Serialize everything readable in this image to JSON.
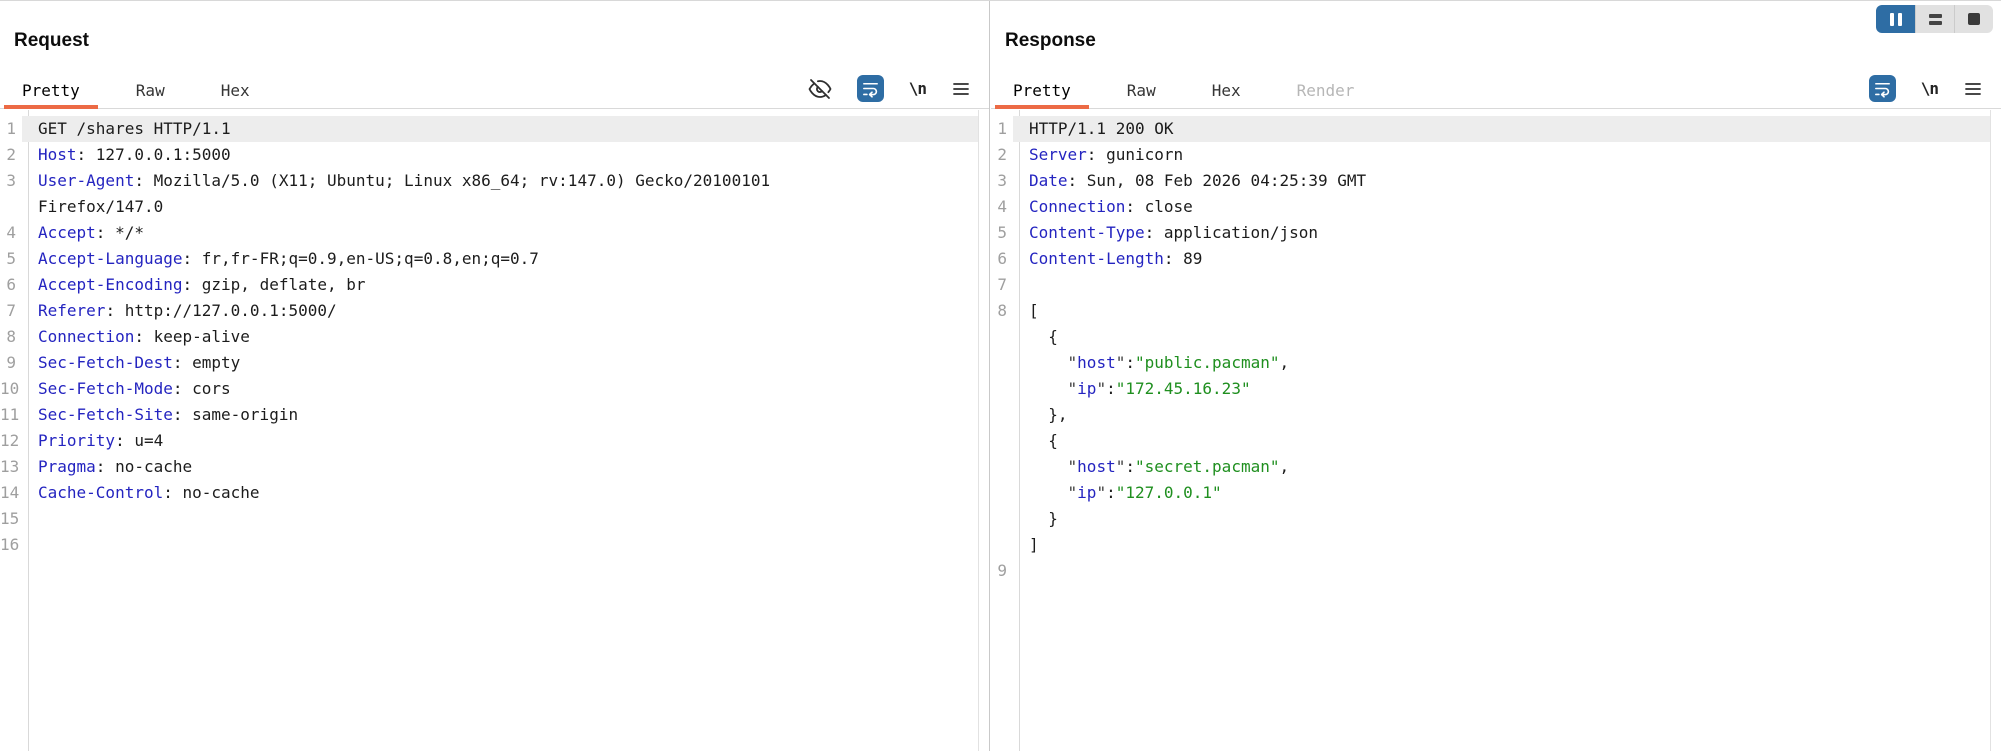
{
  "colors": {
    "tab_underline_orange": "#ec6a45",
    "accent_blue": "#2e6da4",
    "header_name_blue": "#2424c0",
    "string_green": "#1f8f1f",
    "selected_line_bg": "#ededed"
  },
  "request_panel": {
    "title": "Request",
    "tabs": [
      {
        "label": "Pretty",
        "state": "selected"
      },
      {
        "label": "Raw",
        "state": "normal"
      },
      {
        "label": "Hex",
        "state": "normal"
      }
    ],
    "toolbar": {
      "icons": [
        "eye-slash-icon",
        "word-wrap-icon",
        "newline-icon",
        "menu-icon"
      ],
      "newline_label": "\\n"
    },
    "lines": [
      {
        "n": "1",
        "hl": true,
        "parts": [
          [
            "plain",
            "GET /shares HTTP/1.1"
          ]
        ]
      },
      {
        "n": "2",
        "parts": [
          [
            "name",
            "Host"
          ],
          [
            "plain",
            ": 127.0.0.1:5000"
          ]
        ]
      },
      {
        "n": "3",
        "parts": [
          [
            "name",
            "User-Agent"
          ],
          [
            "plain",
            ": Mozilla/5.0 (X11; Ubuntu; Linux x86_64; rv:147.0) Gecko/20100101"
          ]
        ]
      },
      {
        "n": "",
        "parts": [
          [
            "plain",
            "Firefox/147.0"
          ]
        ]
      },
      {
        "n": "4",
        "parts": [
          [
            "name",
            "Accept"
          ],
          [
            "plain",
            ": */*"
          ]
        ]
      },
      {
        "n": "5",
        "parts": [
          [
            "name",
            "Accept-Language"
          ],
          [
            "plain",
            ": fr,fr-FR;q=0.9,en-US;q=0.8,en;q=0.7"
          ]
        ]
      },
      {
        "n": "6",
        "parts": [
          [
            "name",
            "Accept-Encoding"
          ],
          [
            "plain",
            ": gzip, deflate, br"
          ]
        ]
      },
      {
        "n": "7",
        "parts": [
          [
            "name",
            "Referer"
          ],
          [
            "plain",
            ": http://127.0.0.1:5000/"
          ]
        ]
      },
      {
        "n": "8",
        "parts": [
          [
            "name",
            "Connection"
          ],
          [
            "plain",
            ": keep-alive"
          ]
        ]
      },
      {
        "n": "9",
        "parts": [
          [
            "name",
            "Sec-Fetch-Dest"
          ],
          [
            "plain",
            ": empty"
          ]
        ]
      },
      {
        "n": "10",
        "parts": [
          [
            "name",
            "Sec-Fetch-Mode"
          ],
          [
            "plain",
            ": cors"
          ]
        ]
      },
      {
        "n": "11",
        "parts": [
          [
            "name",
            "Sec-Fetch-Site"
          ],
          [
            "plain",
            ": same-origin"
          ]
        ]
      },
      {
        "n": "12",
        "parts": [
          [
            "name",
            "Priority"
          ],
          [
            "plain",
            ": u=4"
          ]
        ]
      },
      {
        "n": "13",
        "parts": [
          [
            "name",
            "Pragma"
          ],
          [
            "plain",
            ": no-cache"
          ]
        ]
      },
      {
        "n": "14",
        "parts": [
          [
            "name",
            "Cache-Control"
          ],
          [
            "plain",
            ": no-cache"
          ]
        ]
      },
      {
        "n": "15",
        "parts": []
      },
      {
        "n": "16",
        "parts": []
      }
    ]
  },
  "response_panel": {
    "title": "Response",
    "tabs": [
      {
        "label": "Pretty",
        "state": "selected"
      },
      {
        "label": "Raw",
        "state": "normal"
      },
      {
        "label": "Hex",
        "state": "normal"
      },
      {
        "label": "Render",
        "state": "disabled"
      }
    ],
    "toolbar": {
      "icons": [
        "word-wrap-icon",
        "newline-icon",
        "menu-icon"
      ],
      "newline_label": "\\n"
    },
    "view_toggle": {
      "buttons": [
        "columns-layout",
        "rows-layout",
        "single-layout"
      ],
      "active": "columns-layout"
    },
    "lines": [
      {
        "n": "1",
        "hl": true,
        "parts": [
          [
            "plain",
            "HTTP/1.1 200 OK"
          ]
        ]
      },
      {
        "n": "2",
        "parts": [
          [
            "name",
            "Server"
          ],
          [
            "plain",
            ": gunicorn"
          ]
        ]
      },
      {
        "n": "3",
        "parts": [
          [
            "name",
            "Date"
          ],
          [
            "plain",
            ": Sun, 08 Feb 2026 04:25:39 GMT"
          ]
        ]
      },
      {
        "n": "4",
        "parts": [
          [
            "name",
            "Connection"
          ],
          [
            "plain",
            ": close"
          ]
        ]
      },
      {
        "n": "5",
        "parts": [
          [
            "name",
            "Content-Type"
          ],
          [
            "plain",
            ": application/json"
          ]
        ]
      },
      {
        "n": "6",
        "parts": [
          [
            "name",
            "Content-Length"
          ],
          [
            "plain",
            ": 89"
          ]
        ]
      },
      {
        "n": "7",
        "parts": []
      },
      {
        "n": "8",
        "parts": [
          [
            "plain",
            "["
          ]
        ]
      },
      {
        "n": "",
        "parts": [
          [
            "plain",
            "  {"
          ]
        ]
      },
      {
        "n": "",
        "parts": [
          [
            "plain",
            "    "
          ],
          [
            "punct",
            "\""
          ],
          [
            "name",
            "host"
          ],
          [
            "punct",
            "\""
          ],
          [
            "plain",
            ":"
          ],
          [
            "string",
            "\"public.pacman\""
          ],
          [
            "plain",
            ","
          ]
        ]
      },
      {
        "n": "",
        "parts": [
          [
            "plain",
            "    "
          ],
          [
            "punct",
            "\""
          ],
          [
            "name",
            "ip"
          ],
          [
            "punct",
            "\""
          ],
          [
            "plain",
            ":"
          ],
          [
            "string",
            "\"172.45.16.23\""
          ]
        ]
      },
      {
        "n": "",
        "parts": [
          [
            "plain",
            "  },"
          ]
        ]
      },
      {
        "n": "",
        "parts": [
          [
            "plain",
            "  {"
          ]
        ]
      },
      {
        "n": "",
        "parts": [
          [
            "plain",
            "    "
          ],
          [
            "punct",
            "\""
          ],
          [
            "name",
            "host"
          ],
          [
            "punct",
            "\""
          ],
          [
            "plain",
            ":"
          ],
          [
            "string",
            "\"secret.pacman\""
          ],
          [
            "plain",
            ","
          ]
        ]
      },
      {
        "n": "",
        "parts": [
          [
            "plain",
            "    "
          ],
          [
            "punct",
            "\""
          ],
          [
            "name",
            "ip"
          ],
          [
            "punct",
            "\""
          ],
          [
            "plain",
            ":"
          ],
          [
            "string",
            "\"127.0.0.1\""
          ]
        ]
      },
      {
        "n": "",
        "parts": [
          [
            "plain",
            "  }"
          ]
        ]
      },
      {
        "n": "",
        "parts": [
          [
            "plain",
            "]"
          ]
        ]
      },
      {
        "n": "9",
        "parts": []
      }
    ]
  }
}
